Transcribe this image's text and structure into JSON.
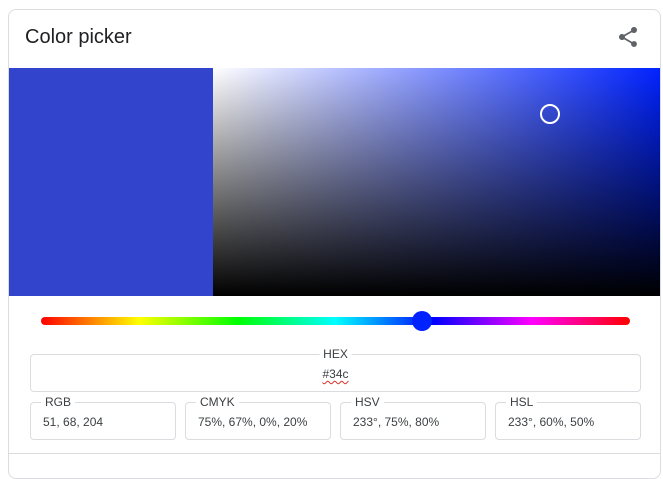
{
  "header": {
    "title": "Color picker",
    "share_icon": "share-icon"
  },
  "color": {
    "hex_value": "#34c",
    "swatch_hex": "#3344cc",
    "hue_color_hex": "#0022ff",
    "hue_handle_hex": "#0022ff",
    "hue_degrees": 233,
    "saturation_fraction": 0.75,
    "value_fraction": 0.8
  },
  "fields": {
    "hex": {
      "label": "HEX",
      "value": "#34c"
    },
    "rgb": {
      "label": "RGB",
      "value": "51, 68, 204"
    },
    "cmyk": {
      "label": "CMYK",
      "value": "75%, 67%, 0%, 20%"
    },
    "hsv": {
      "label": "HSV",
      "value": "233°, 75%, 80%"
    },
    "hsl": {
      "label": "HSL",
      "value": "233°, 60%, 50%"
    }
  }
}
